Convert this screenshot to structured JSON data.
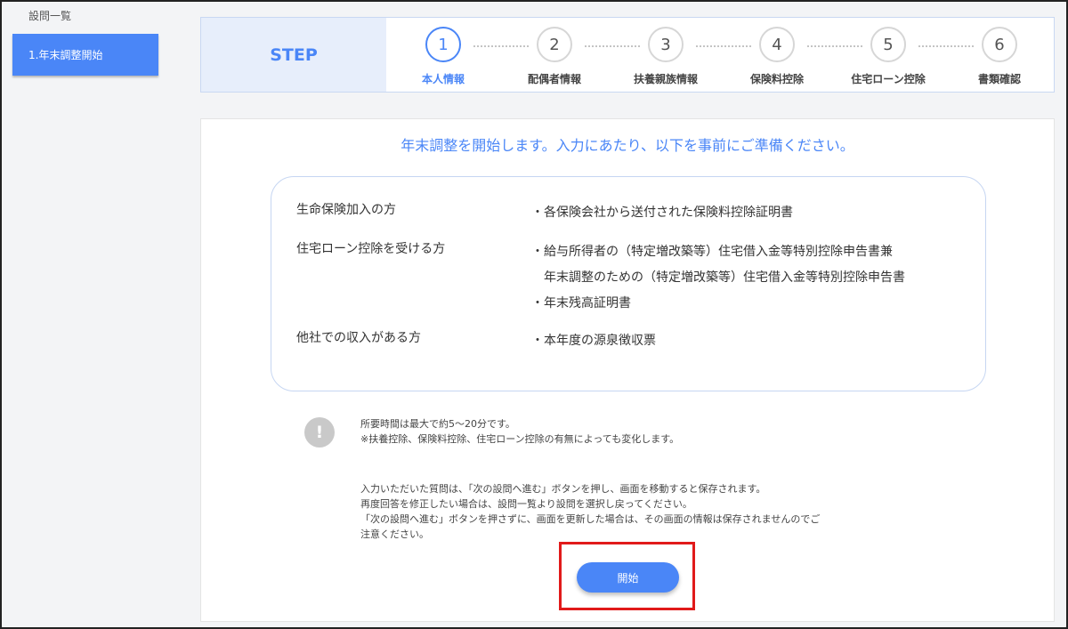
{
  "sidebar": {
    "heading": "設問一覧",
    "items": [
      {
        "label": "1.年末調整開始"
      }
    ]
  },
  "stepper": {
    "label": "STEP",
    "steps": [
      {
        "number": "1",
        "name": "本人情報"
      },
      {
        "number": "2",
        "name": "配偶者情報"
      },
      {
        "number": "3",
        "name": "扶養親族情報"
      },
      {
        "number": "4",
        "name": "保険料控除"
      },
      {
        "number": "5",
        "name": "住宅ローン控除"
      },
      {
        "number": "6",
        "name": "書類確認"
      }
    ],
    "active_step": 1
  },
  "main": {
    "headline": "年末調整を開始します。入力にあたり、以下を事前にご準備ください。",
    "preparation": [
      {
        "label": "生命保険加入の方",
        "docs": [
          "・各保険会社から送付された保険料控除証明書"
        ]
      },
      {
        "label": "住宅ローン控除を受ける方",
        "docs": [
          "・給与所得者の（特定増改築等）住宅借入金等特別控除申告書兼",
          "　年末調整のための（特定増改築等）住宅借入金等特別控除申告書",
          "・年末残高証明書"
        ]
      },
      {
        "label": "他社での収入がある方",
        "docs": [
          "・本年度の源泉徴収票"
        ]
      }
    ],
    "notice_icon": "!",
    "time_note": [
      "所要時間は最大で約5～20分です。",
      "※扶養控除、保険料控除、住宅ローン控除の有無によっても変化します。"
    ],
    "save_note": [
      "入力いただいた質問は、「次の設問へ進む」ボタンを押し、画面を移動すると保存されます。",
      "再度回答を修正したい場合は、設問一覧より設問を選択し戻ってください。",
      "「次の設問へ進む」ボタンを押さずに、画面を更新した場合は、その画面の情報は保存されませんのでご",
      "注意ください。"
    ],
    "start_button": "開始"
  },
  "colors": {
    "accent": "#4a86f7",
    "highlight": "#e11a1a",
    "step_bg": "#e7eefb"
  }
}
